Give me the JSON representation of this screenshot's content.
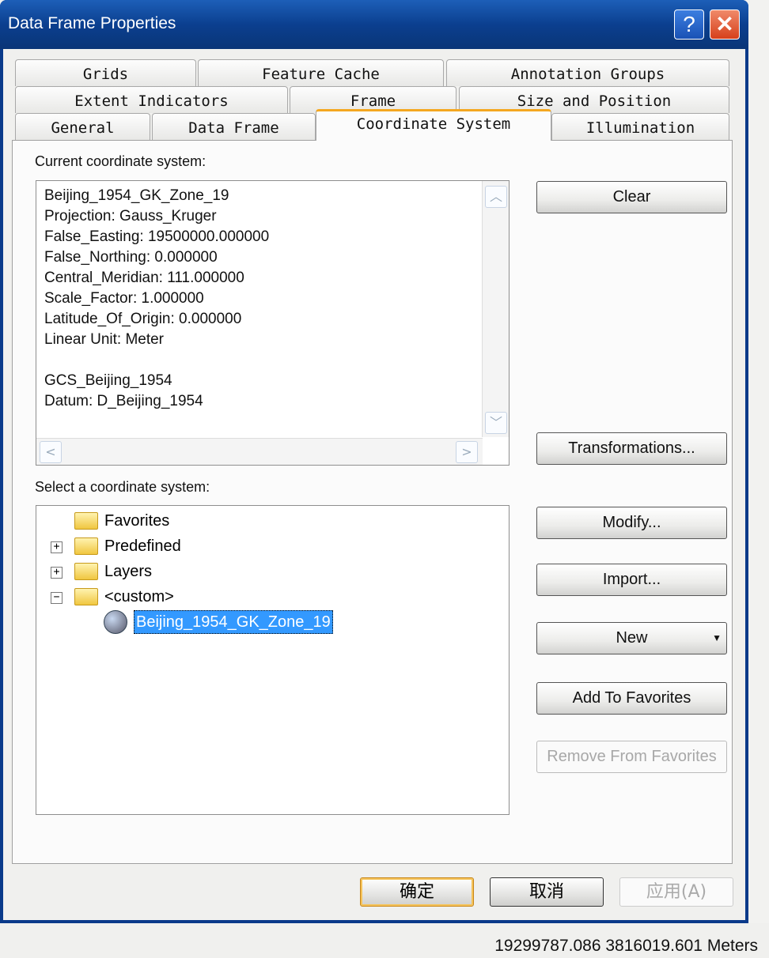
{
  "window": {
    "title": "Data Frame Properties",
    "help_icon": "?",
    "close_icon": "✕"
  },
  "tabs": {
    "row1": [
      "Grids",
      "Feature Cache",
      "Annotation Groups"
    ],
    "row2": [
      "Extent Indicators",
      "Frame",
      "Size and Position"
    ],
    "row3": [
      "General",
      "Data Frame",
      "Coordinate System",
      "Illumination"
    ],
    "active": "Coordinate System"
  },
  "current": {
    "label": "Current coordinate system:",
    "text": "Beijing_1954_GK_Zone_19\nProjection: Gauss_Kruger\nFalse_Easting: 19500000.000000\nFalse_Northing: 0.000000\nCentral_Meridian: 111.000000\nScale_Factor: 1.000000\nLatitude_Of_Origin: 0.000000\nLinear Unit: Meter\n\nGCS_Beijing_1954\nDatum: D_Beijing_1954"
  },
  "select": {
    "label": "Select a coordinate system:",
    "tree": [
      {
        "label": "Favorites"
      },
      {
        "label": "Predefined",
        "toggle": "+"
      },
      {
        "label": "Layers",
        "toggle": "+"
      },
      {
        "label": "<custom>",
        "toggle": "−"
      },
      {
        "label": "Beijing_1954_GK_Zone_19",
        "selected": true
      }
    ]
  },
  "buttons": {
    "clear": "Clear",
    "transformations": "Transformations...",
    "modify": "Modify...",
    "import": "Import...",
    "new": "New",
    "add_fav": "Add To Favorites",
    "remove_fav": "Remove From Favorites"
  },
  "dialog": {
    "ok": "确定",
    "cancel": "取消",
    "apply": "应用(A)"
  },
  "status": {
    "coords": "19299787.086  3816019.601 Meters"
  },
  "colors": {
    "title_bar": "#0b3f8f",
    "active_tab_accent": "#f4a720",
    "selection": "#3399ff"
  }
}
